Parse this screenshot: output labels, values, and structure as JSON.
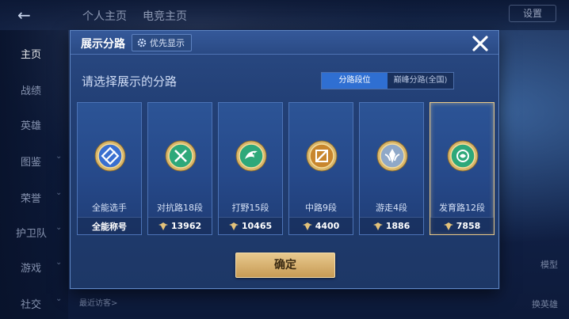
{
  "background": {
    "top_tabs": [
      "个人主页",
      "电竞主页"
    ],
    "settings_label": "设置",
    "sidebar": [
      {
        "label": "主页",
        "active": true,
        "has_chevron": false
      },
      {
        "label": "战绩",
        "active": false,
        "has_chevron": false
      },
      {
        "label": "英雄",
        "active": false,
        "has_chevron": false
      },
      {
        "label": "图鉴",
        "active": false,
        "has_chevron": true
      },
      {
        "label": "荣誉",
        "active": false,
        "has_chevron": true
      },
      {
        "label": "护卫队",
        "active": false,
        "has_chevron": true
      },
      {
        "label": "游戏",
        "active": false,
        "has_chevron": true
      },
      {
        "label": "社交",
        "active": false,
        "has_chevron": true
      }
    ],
    "visitors_label": "最近访客>",
    "right_buttons": [
      "模型",
      "换英雄"
    ]
  },
  "modal": {
    "title": "展示分路",
    "priority_button": "优先显示",
    "prompt": "请选择展示的分路",
    "toggle": {
      "options": [
        "分路段位",
        "巅峰分路(全国)"
      ],
      "active_index": 0
    },
    "cards": [
      {
        "label": "全能选手",
        "value": "全能称号",
        "show_icon": false,
        "emblem": "all-round-emblem-icon",
        "color": "#3a6fd0"
      },
      {
        "label": "对抗路18段",
        "value": "13962",
        "show_icon": true,
        "emblem": "clash-lane-emblem-icon",
        "color": "#2ea87a"
      },
      {
        "label": "打野15段",
        "value": "10465",
        "show_icon": true,
        "emblem": "jungle-emblem-icon",
        "color": "#2ea87a"
      },
      {
        "label": "中路9段",
        "value": "4400",
        "show_icon": true,
        "emblem": "mid-lane-emblem-icon",
        "color": "#c8862e"
      },
      {
        "label": "游走4段",
        "value": "1886",
        "show_icon": true,
        "emblem": "roam-emblem-icon",
        "color": "#8fa8c8"
      },
      {
        "label": "发育路12段",
        "value": "7858",
        "show_icon": true,
        "emblem": "farm-lane-emblem-icon",
        "color": "#2ea87a"
      }
    ],
    "selected_index": 5,
    "confirm_label": "确定",
    "accent_color": "#e8c98e"
  }
}
